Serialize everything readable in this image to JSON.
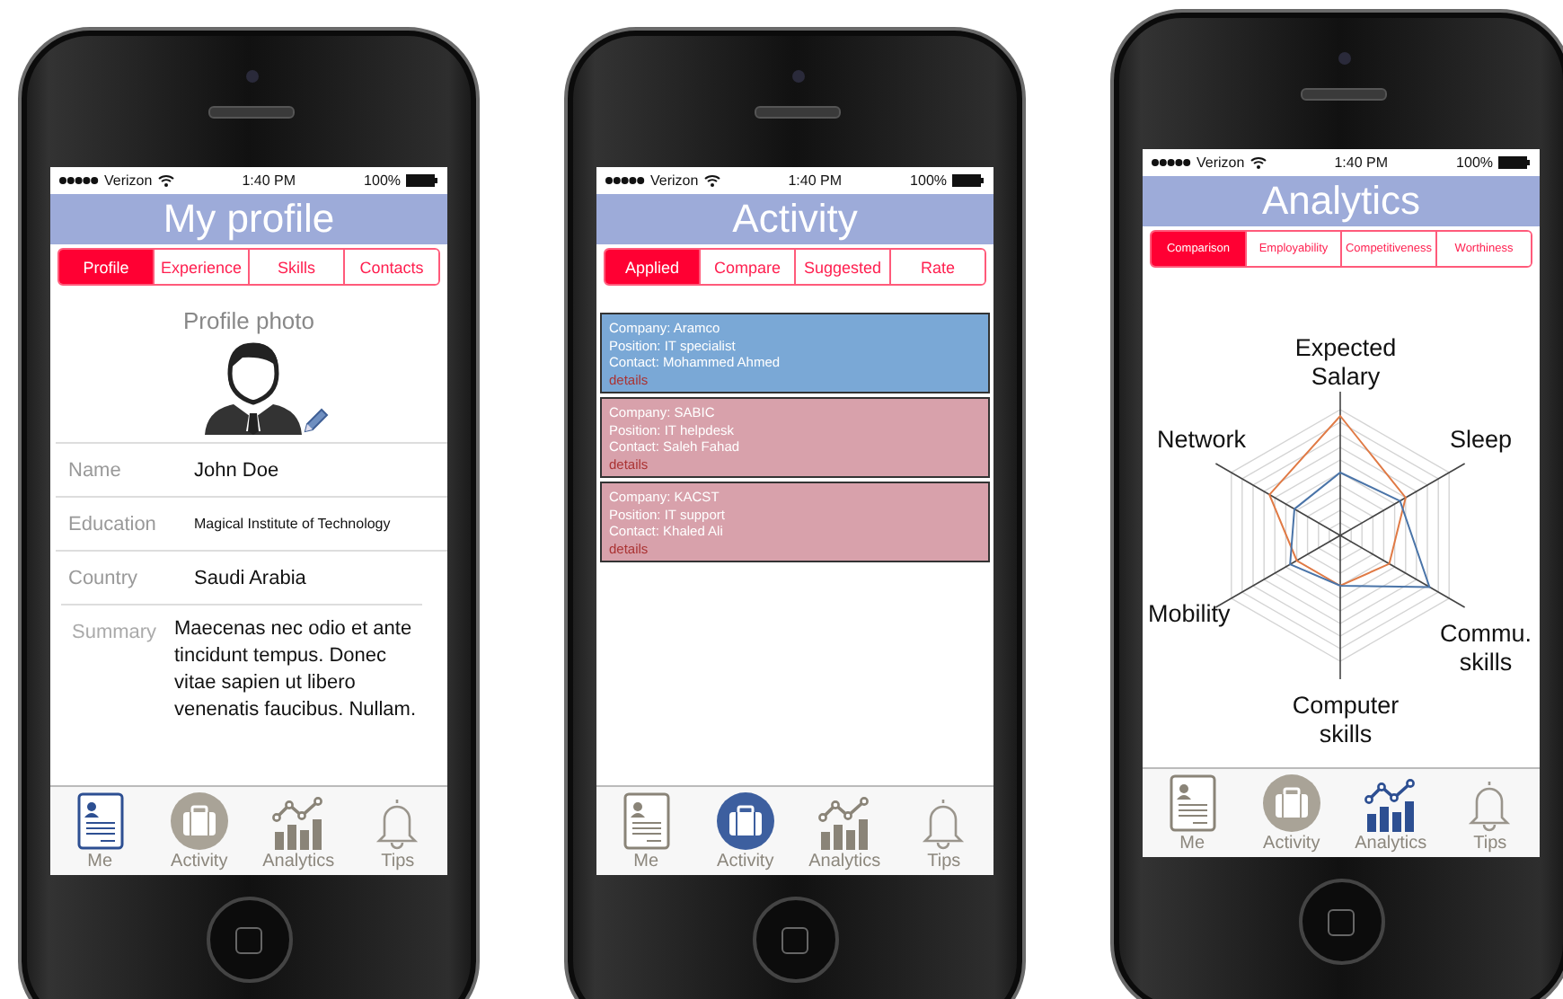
{
  "phones": [
    {
      "kind": "profile",
      "status": {
        "carrier": "Verizon",
        "time": "1:40 PM",
        "battery": "100%"
      },
      "title": "My profile",
      "segments": [
        {
          "label": "Profile",
          "selected": true
        },
        {
          "label": "Experience",
          "selected": false
        },
        {
          "label": "Skills",
          "selected": false
        },
        {
          "label": "Contacts",
          "selected": false
        }
      ],
      "photo_label": "Profile photo",
      "fields": [
        {
          "label": "Name",
          "value": "John Doe"
        },
        {
          "label": "Education",
          "value": "Magical Institute of Technology"
        },
        {
          "label": "Country",
          "value": "Saudi Arabia"
        }
      ],
      "summary": {
        "label": "Summary",
        "value": "Maecenas nec odio et ante tincidunt tempus. Donec vitae sapien ut libero venenatis faucibus. Nullam."
      },
      "tabbar": [
        {
          "label": "Me",
          "selected": true
        },
        {
          "label": "Activity",
          "selected": false
        },
        {
          "label": "Analytics",
          "selected": false
        },
        {
          "label": "Tips",
          "selected": false
        }
      ]
    },
    {
      "kind": "list",
      "status": {
        "carrier": "Verizon",
        "time": "1:40 PM",
        "battery": "100%"
      },
      "title": "Activity",
      "segments": [
        {
          "label": "Applied",
          "selected": true
        },
        {
          "label": "Compare",
          "selected": false
        },
        {
          "label": "Suggested",
          "selected": false
        },
        {
          "label": "Rate",
          "selected": false
        }
      ],
      "cards": [
        {
          "color": "#7aa8d6",
          "lines": [
            "Company: Aramco",
            "Position: IT specialist",
            "Contact: Mohammed Ahmed"
          ],
          "link": "details"
        },
        {
          "color": "#d8a1ab",
          "lines": [
            "Company: SABIC",
            "Position: IT helpdesk",
            "Contact: Saleh Fahad"
          ],
          "link": "details"
        },
        {
          "color": "#d8a1ab",
          "lines": [
            "Company: KACST",
            "Position: IT support",
            "Contact: Khaled Ali"
          ],
          "link": "details"
        }
      ],
      "tabbar": [
        {
          "label": "Me",
          "selected": false
        },
        {
          "label": "Activity",
          "selected": true
        },
        {
          "label": "Analytics",
          "selected": false
        },
        {
          "label": "Tips",
          "selected": false
        }
      ]
    },
    {
      "kind": "chart",
      "status": {
        "carrier": "Verizon",
        "time": "1:40 PM",
        "battery": "100%"
      },
      "title": "Analytics",
      "segments": [
        {
          "label": "Comparison",
          "selected": true
        },
        {
          "label": "Employability",
          "selected": false
        },
        {
          "label": "Competitiveness",
          "selected": false
        },
        {
          "label": "Worthiness",
          "selected": false
        }
      ],
      "axes": [
        "Expected Salary",
        "Sleep",
        "Commu. skills",
        "Computer skills",
        "Mobility",
        "Network"
      ],
      "tabbar": [
        {
          "label": "Me",
          "selected": false
        },
        {
          "label": "Activity",
          "selected": false
        },
        {
          "label": "Analytics",
          "selected": true
        },
        {
          "label": "Tips",
          "selected": false
        }
      ]
    }
  ]
}
